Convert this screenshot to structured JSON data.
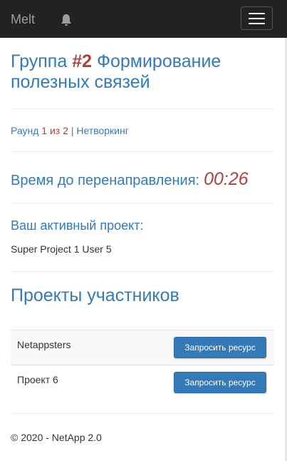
{
  "navbar": {
    "brand": "Melt",
    "bell_icon": "bell-icon",
    "menu_icon": "hamburger-menu-icon"
  },
  "group": {
    "prefix": "Группа",
    "number": "#2",
    "name": "Формирование полезных связей"
  },
  "round": {
    "label": "Раунд",
    "current": "1",
    "of": "из",
    "total": "2",
    "separator": "|",
    "stage": "Нетворкинг"
  },
  "timer": {
    "label": "Время до перенаправления:",
    "value": "00:26"
  },
  "active_project": {
    "heading": "Ваш активный проект:",
    "value": "Super Project 1 User 5"
  },
  "projects": {
    "heading": "Проекты участников",
    "rows": [
      {
        "name": "Netappsters",
        "button": "Запросить ресурс"
      },
      {
        "name": "Проект 6",
        "button": "Запросить ресурс"
      }
    ]
  },
  "footer": {
    "text": "© 2020 - NetApp 2.0"
  },
  "colors": {
    "navbar_bg": "#222222",
    "link": "#337ab7",
    "danger": "#a94442",
    "primary_button": "#337ab7"
  }
}
